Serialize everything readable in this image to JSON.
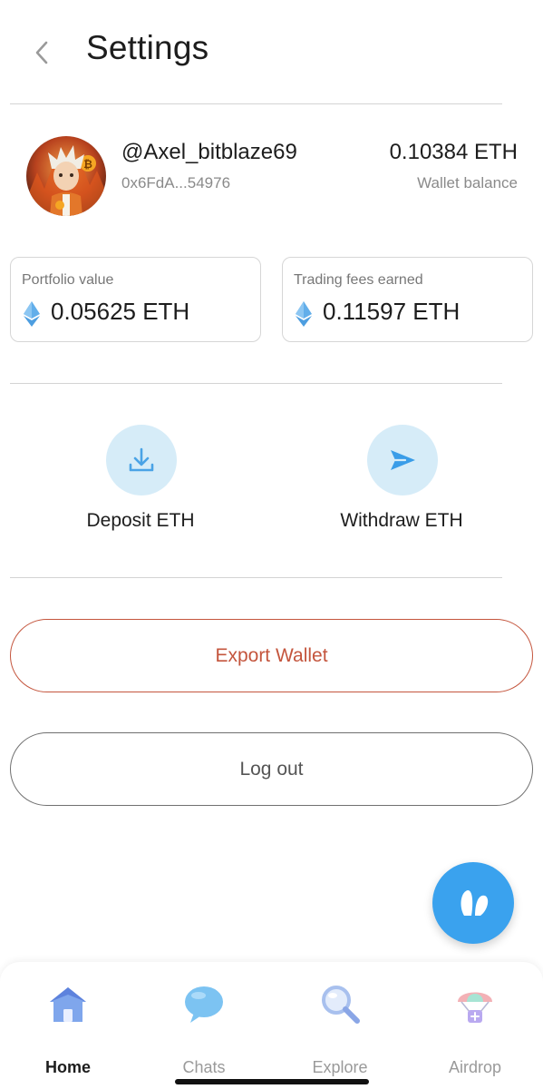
{
  "header": {
    "title": "Settings"
  },
  "profile": {
    "username": "@Axel_bitblaze69",
    "address": "0x6FdA...54976",
    "balance": "0.10384 ETH",
    "balance_label": "Wallet balance"
  },
  "cards": [
    {
      "label": "Portfolio value",
      "value": "0.05625 ETH"
    },
    {
      "label": "Trading fees earned",
      "value": "0.11597 ETH"
    }
  ],
  "actions": {
    "deposit_label": "Deposit ETH",
    "withdraw_label": "Withdraw ETH"
  },
  "buttons": {
    "export_label": "Export Wallet",
    "logout_label": "Log out"
  },
  "tabs": [
    {
      "label": "Home",
      "icon": "home-icon",
      "active": true
    },
    {
      "label": "Chats",
      "icon": "chat-bubble-icon",
      "active": false
    },
    {
      "label": "Explore",
      "icon": "magnifier-icon",
      "active": false
    },
    {
      "label": "Airdrop",
      "icon": "parachute-icon",
      "active": false
    }
  ],
  "colors": {
    "accent_blue": "#3aa2ee",
    "action_circle": "#d6ecf8",
    "export_red": "#c4553d",
    "eth_blue": "#5aa9e6"
  }
}
